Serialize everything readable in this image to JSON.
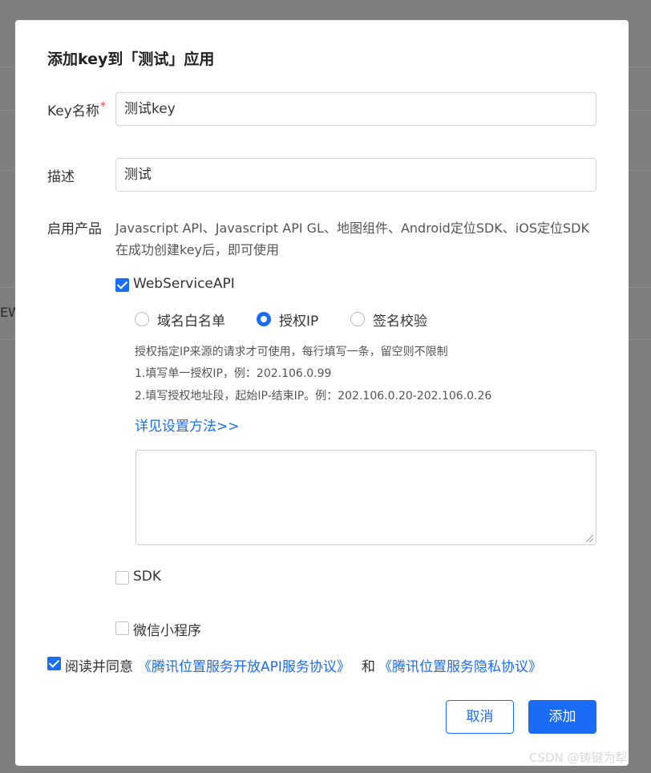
{
  "background": {
    "fragment_text": "EW"
  },
  "dialog": {
    "title": "添加key到「测试」应用",
    "fields": {
      "key_name_label": "Key名称",
      "required_mark": "*",
      "key_name_value": "测试key",
      "desc_label": "描述",
      "desc_value": "测试"
    },
    "products": {
      "label": "启用产品",
      "info": "Javascript API、Javascript API GL、地图组件、Android定位SDK、iOS定位SDK在成功创建key后，即可使用",
      "webservice": {
        "label": "WebServiceAPI",
        "checked": true
      },
      "radios": [
        {
          "label": "域名白名单",
          "selected": false
        },
        {
          "label": "授权IP",
          "selected": true
        },
        {
          "label": "签名校验",
          "selected": false
        }
      ],
      "hints": [
        "授权指定IP来源的请求才可使用，每行填写一条，留空则不限制",
        "1.填写单一授权IP，例：202.106.0.99",
        "2.填写授权地址段，起始IP-结束IP。例：202.106.0.20-202.106.0.26"
      ],
      "settings_link": "详见设置方法>>",
      "ip_textarea_value": "",
      "sdk": {
        "label": "SDK",
        "checked": false
      },
      "miniprogram": {
        "label": "微信小程序",
        "checked": false
      }
    },
    "agreement": {
      "checked": true,
      "prefix": "阅读并同意",
      "link1": "《腾讯位置服务开放API服务协议》",
      "connector": "和",
      "link2": "《腾讯位置服务隐私协议》"
    },
    "buttons": {
      "cancel": "取消",
      "add": "添加"
    }
  },
  "watermark": "CSDN @铸键为犁",
  "colors": {
    "accent": "#1a6cf5",
    "required": "#e5484d",
    "overlay": "#7f7f7f"
  }
}
